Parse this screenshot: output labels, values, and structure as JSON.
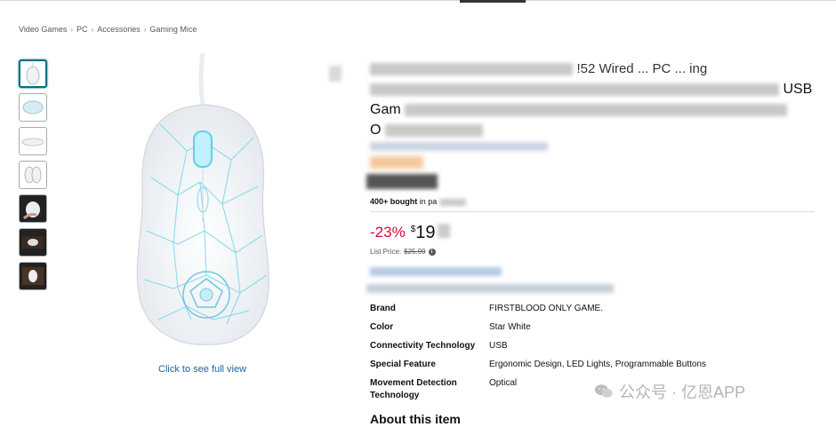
{
  "breadcrumb": [
    "Video Games",
    "PC",
    "Accessories",
    "Gaming Mice"
  ],
  "breadcrumb_separator": "›",
  "title": {
    "line1_visible": "!52 Wired ... PC ... ing",
    "line2_visible": "USB",
    "line3_visible": "Gam",
    "line4_visible": "O"
  },
  "bought": {
    "bold": "400+ bought",
    "rest": "in pa"
  },
  "price": {
    "discount": "-23%",
    "symbol": "$",
    "whole": "19",
    "list_label": "List Price:",
    "list_value": "$25.99"
  },
  "specs": [
    {
      "key": "Brand",
      "value": "FIRSTBLOOD ONLY GAME."
    },
    {
      "key": "Color",
      "value": "Star White"
    },
    {
      "key": "Connectivity Technology",
      "value": "USB"
    },
    {
      "key": "Special Feature",
      "value": "Ergonomic Design, LED Lights, Programmable Buttons"
    },
    {
      "key": "Movement Detection Technology",
      "value": "Optical"
    }
  ],
  "full_view_link": "Click to see full view",
  "about_heading": "About this item",
  "watermark": "公众号 · 亿恩APP",
  "colors": {
    "accent_link": "#2162a1",
    "discount": "#cc0c39",
    "thumb_active": "#007185"
  }
}
